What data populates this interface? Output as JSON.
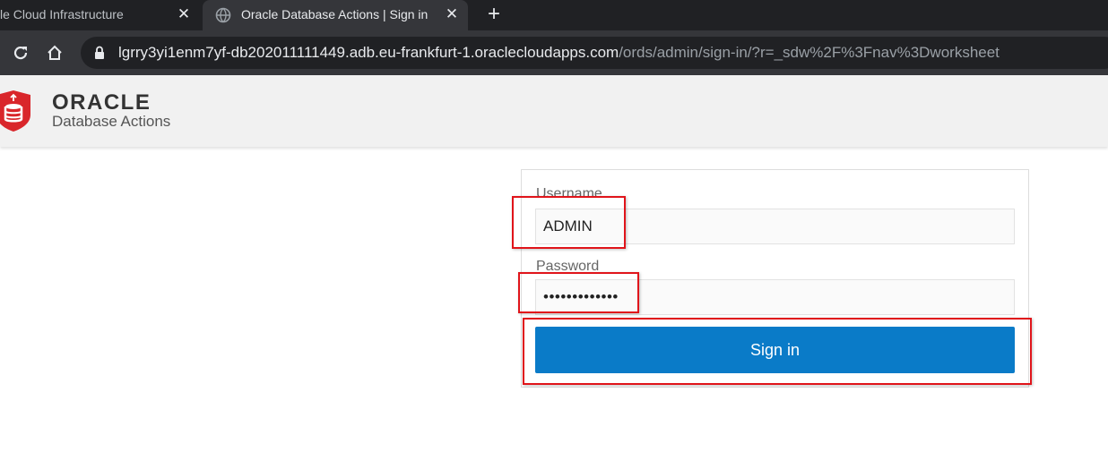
{
  "browser": {
    "tabs": [
      {
        "title": "le Cloud Infrastructure",
        "close": "✕"
      },
      {
        "title": "Oracle Database Actions | Sign in",
        "close": "✕"
      }
    ],
    "new_tab": "+",
    "url_host": "lgrry3yi1enm7yf-db202011111449.adb.eu-frankfurt-1.oraclecloudapps.com",
    "url_path": "/ords/admin/sign-in/?r=_sdw%2F%3Fnav%3Dworksheet"
  },
  "header": {
    "brand": "ORACLE",
    "product": "Database Actions"
  },
  "signin_form": {
    "username_label": "Username",
    "username_value": "ADMIN",
    "password_label": "Password",
    "password_value": "•••••••••••••",
    "button_label": "Sign in"
  },
  "colors": {
    "accent": "#0a7bc8",
    "oracle_red": "#d9262b",
    "highlight": "#e0141a"
  }
}
